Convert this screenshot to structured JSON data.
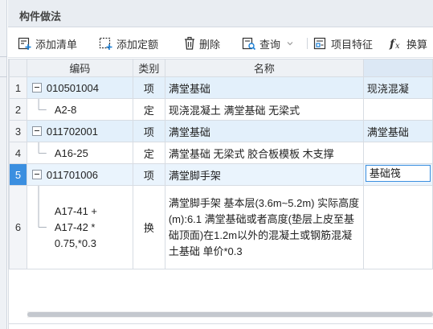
{
  "panel": {
    "title": "构件做法"
  },
  "toolbar": {
    "add_list": "添加清单",
    "add_quota": "添加定额",
    "delete": "删除",
    "query": "查询",
    "item_feature": "项目特征",
    "convert": "换算",
    "icons": {
      "add_list": "add-list-icon",
      "add_quota": "add-quota-icon",
      "delete": "trash-icon",
      "query": "query-icon",
      "item_feature": "feature-icon",
      "convert": "fx-icon"
    }
  },
  "table": {
    "columns": [
      "编码",
      "类别",
      "名称",
      ""
    ],
    "rows": [
      {
        "num": "1",
        "code": "010501004",
        "type": "项",
        "name": "满堂基础",
        "extra": "现浇混凝",
        "expandable": true
      },
      {
        "num": "2",
        "code": "A2-8",
        "type": "定",
        "name": "现浇混凝土 满堂基础 无梁式",
        "extra": "",
        "expandable": false
      },
      {
        "num": "3",
        "code": "011702001",
        "type": "项",
        "name": "满堂基础",
        "extra": "满堂基础",
        "expandable": true
      },
      {
        "num": "4",
        "code": "A16-25",
        "type": "定",
        "name": "满堂基础 无梁式 胶合板模板 木支撑",
        "extra": "",
        "expandable": false
      },
      {
        "num": "5",
        "code": "011701006",
        "type": "项",
        "name": "满堂脚手架",
        "extra": "基础筏",
        "expandable": true,
        "selected": true
      },
      {
        "num": "6",
        "code": "A17-41 + A17-42 * 0.75,*0.3",
        "type": "换",
        "name": "满堂脚手架 基本层(3.6m~5.2m) 实际高度(m):6.1  满堂基础或者高度(垫层上皮至基础顶面)在1.2m以外的混凝土或钢筋混凝土基础 单价*0.3",
        "extra": "",
        "expandable": false
      }
    ]
  }
}
